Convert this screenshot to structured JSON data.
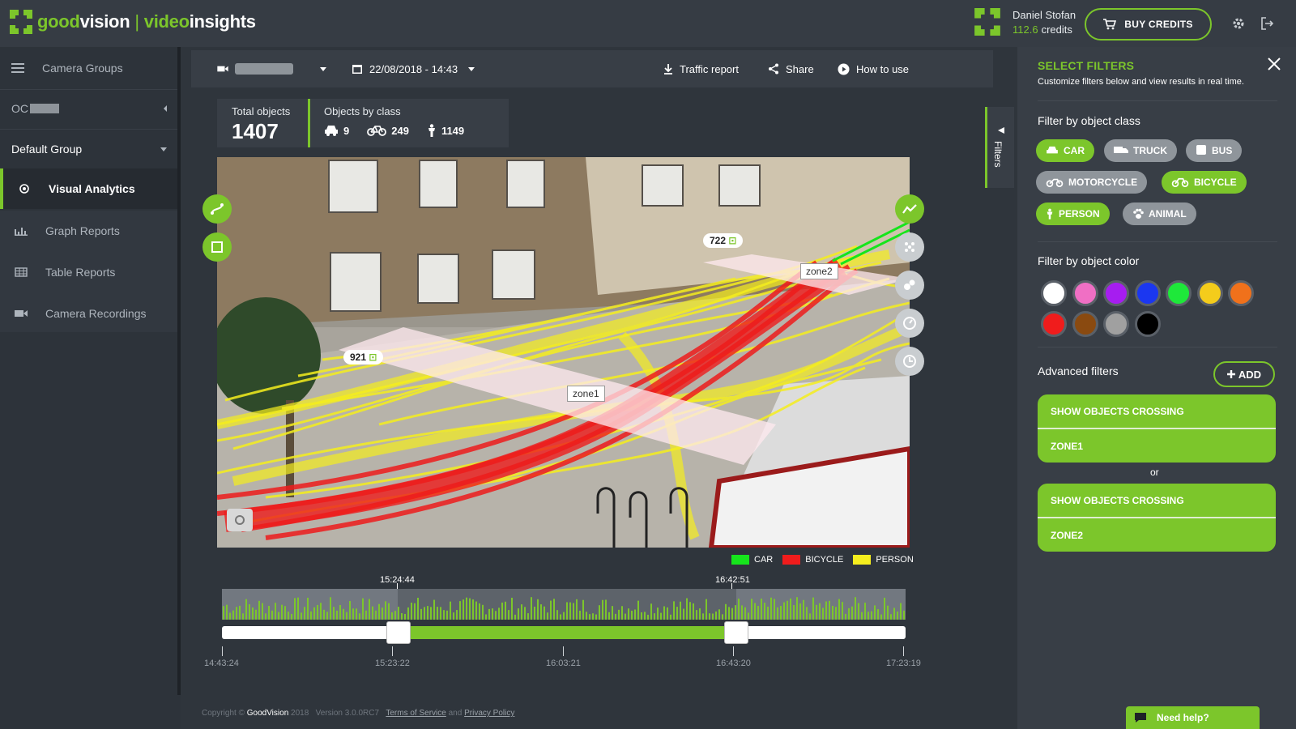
{
  "app": {
    "brand_left_plain": "good",
    "brand_left_green": "vision",
    "brand_sep": "|",
    "brand_right_green": "video",
    "brand_right_plain": "insights",
    "accent": "#7cc62b"
  },
  "user": {
    "name": "Daniel Stofan",
    "credits_value": "112.6",
    "credits_label": "credits",
    "buy_label": "BUY CREDITS"
  },
  "sidebar": {
    "items": [
      {
        "label": "Camera Groups",
        "icon": "list-icon"
      },
      {
        "label": "OC",
        "icon": "chevron-left-icon"
      },
      {
        "label": "Default Group",
        "icon": "caret-down-icon"
      },
      {
        "label": "Visual Analytics",
        "icon": "eye-icon",
        "active": true
      },
      {
        "label": "Graph Reports",
        "icon": "bar-chart-icon"
      },
      {
        "label": "Table Reports",
        "icon": "table-icon"
      },
      {
        "label": "Camera Recordings",
        "icon": "video-camera-icon"
      }
    ]
  },
  "toolbar": {
    "datetime": "22/08/2018 - 14:43",
    "traffic_report": "Traffic report",
    "share": "Share",
    "how_to_use": "How to use"
  },
  "stats": {
    "total_label": "Total objects",
    "total_value": "1407",
    "class_label": "Objects by class",
    "car": "9",
    "bicycle": "249",
    "person": "1149"
  },
  "video": {
    "zone1_label": "zone1",
    "zone2_label": "zone2",
    "count_left": "921",
    "count_right": "722"
  },
  "legend": [
    {
      "label": "CAR",
      "color": "#16e51c"
    },
    {
      "label": "BICYCLE",
      "color": "#f01c1c"
    },
    {
      "label": "PERSON",
      "color": "#f5ee1e"
    }
  ],
  "timeline": {
    "selected_start": "15:24:44",
    "selected_end": "16:42:51",
    "ticks": [
      "14:43:24",
      "15:23:22",
      "16:03:21",
      "16:43:20",
      "17:23:19"
    ],
    "selection_start_fraction": 0.257,
    "selection_end_fraction": 0.752
  },
  "footer": {
    "copyright": "Copyright ©",
    "company": "GoodVision",
    "year": "2018",
    "version": "Version 3.0.0RC7",
    "terms": "Terms of Service",
    "and": "and",
    "privacy": "Privacy Policy"
  },
  "filters_tab": {
    "label": "Filters"
  },
  "panel": {
    "title": "SELECT FILTERS",
    "subtitle": "Customize filters below and view results in real time.",
    "class_heading": "Filter by object class",
    "classes": [
      {
        "label": "CAR",
        "on": true
      },
      {
        "label": "TRUCK",
        "on": false
      },
      {
        "label": "BUS",
        "on": false
      },
      {
        "label": "MOTORCYCLE",
        "on": false
      },
      {
        "label": "BICYCLE",
        "on": true
      },
      {
        "label": "PERSON",
        "on": true
      },
      {
        "label": "ANIMAL",
        "on": false
      }
    ],
    "color_heading": "Filter by object color",
    "colors": [
      "#ffffff",
      "#f06fc4",
      "#a61df0",
      "#1b37f0",
      "#1ee83a",
      "#f4cc1b",
      "#f0711b",
      "#f01c1c",
      "#8a4a10",
      "#a0a0a0",
      "#000000"
    ],
    "advanced_heading": "Advanced filters",
    "add_label": "ADD",
    "crossing_label": "SHOW OBJECTS CROSSING",
    "zone1": "ZONE1",
    "or_label": "or",
    "zone2": "ZONE2",
    "help_label": "Need help?"
  }
}
